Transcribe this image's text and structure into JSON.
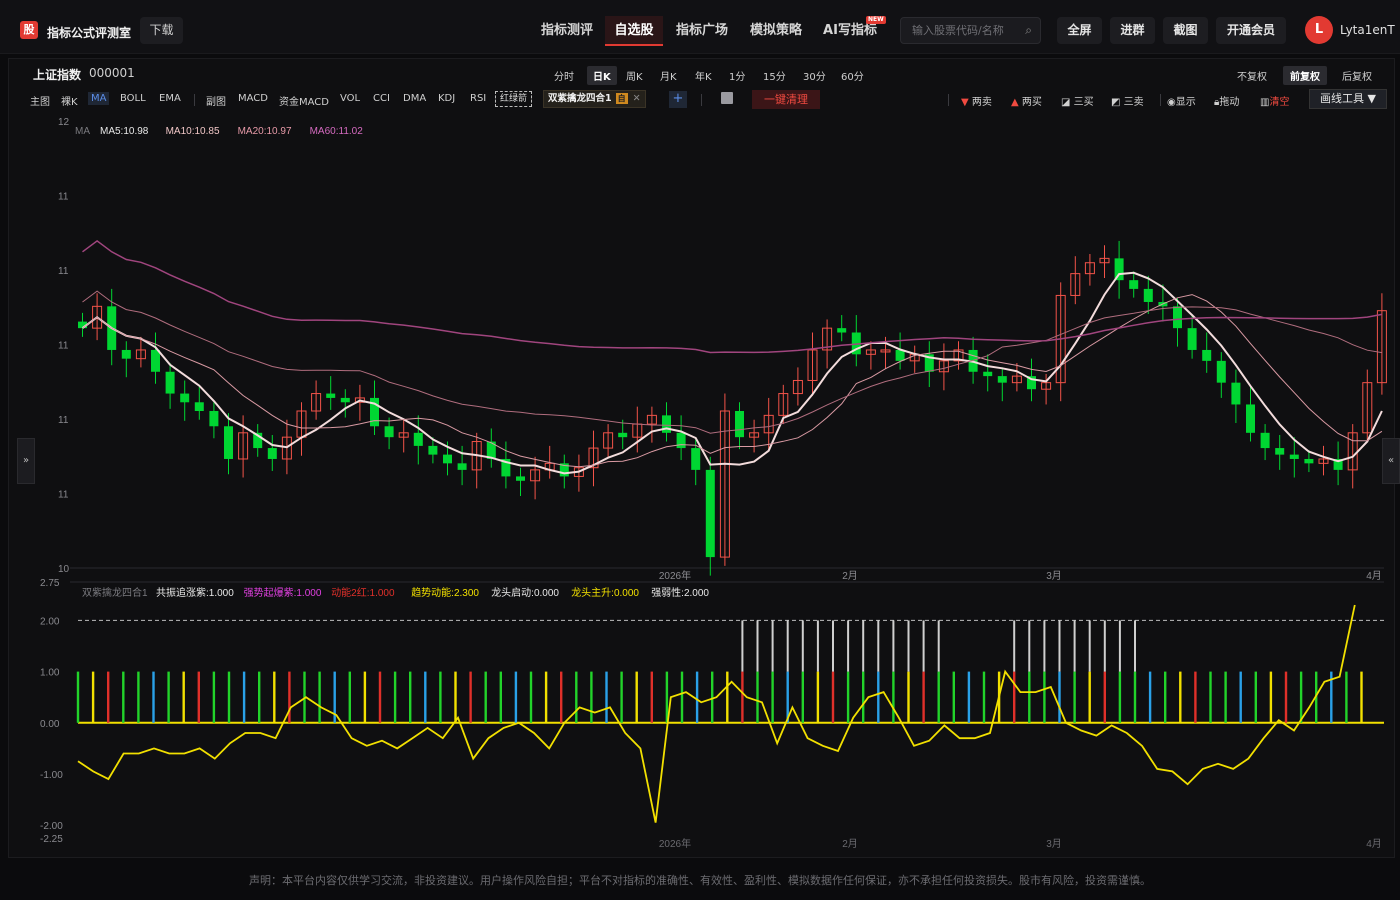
{
  "topbar": {
    "logo": "股",
    "app_name": "指标公式评测室",
    "download": "下载",
    "nav": [
      "指标测评",
      "自选股",
      "指标广场",
      "模拟策略",
      "AI写指标"
    ],
    "nav_active": 1,
    "new_badge": "NEW",
    "search_placeholder": "输入股票代码/名称",
    "buttons": [
      "全屏",
      "进群",
      "截图",
      "开通会员"
    ],
    "avatar": "L",
    "username": "Lyta1enT"
  },
  "stock": {
    "name": "上证指数",
    "code": "000001"
  },
  "periods": [
    "分时",
    "日K",
    "周K",
    "月K",
    "年K",
    "1分",
    "15分",
    "30分",
    "60分"
  ],
  "period_active": 1,
  "fuquan": [
    "不复权",
    "前复权",
    "后复权"
  ],
  "fuquan_active": 1,
  "indicators": {
    "main": [
      "主图",
      "裸K",
      "MA",
      "BOLL",
      "EMA"
    ],
    "main_active": 2,
    "sub": [
      "副图",
      "MACD",
      "资金MACD",
      "VOL",
      "CCI",
      "DMA",
      "KDJ",
      "RSI"
    ],
    "redgreen": "红绿箭",
    "combo": "双紫擒龙四合1",
    "combo_tag": "自",
    "clear": "一键清理"
  },
  "tools": [
    "两卖",
    "两买",
    "三买",
    "三卖",
    "显示",
    "拖动",
    "清空"
  ],
  "draw_tool": "画线工具 ▼",
  "side": {
    "left": "»",
    "right": "«"
  },
  "colors": {
    "up": "#f25349",
    "down": "#00d632",
    "bg": "#0f0f11"
  },
  "chart_data": [
    {
      "type": "candlestick",
      "ylim": [
        10,
        12
      ],
      "yticks": [
        "12",
        "11",
        "11",
        "11",
        "11",
        "11",
        "10"
      ],
      "xticks": [
        "2026年",
        "2月",
        "3月",
        "4月"
      ],
      "legend": [
        {
          "label": "MA",
          "value": ""
        },
        {
          "label": "MA5",
          "value": "10.98"
        },
        {
          "label": "MA10",
          "value": "10.85"
        },
        {
          "label": "MA20",
          "value": "10.97"
        },
        {
          "label": "MA60",
          "value": "11.02"
        }
      ]
    },
    {
      "type": "indicator",
      "title": "双紫擒龙四合1",
      "ylim": [
        -2.25,
        2.75
      ],
      "yticks": [
        "2.75",
        "2.00",
        "1.00",
        "0.00",
        "-1.00",
        "-2.00",
        "-2.25"
      ],
      "xticks": [
        "2026年",
        "2月",
        "3月",
        "4月"
      ],
      "legend": [
        {
          "label": "共振追涨紫",
          "value": "1.000"
        },
        {
          "label": "强势起爆紫",
          "value": "1.000"
        },
        {
          "label": "动能2红",
          "value": "1.000"
        },
        {
          "label": "趋势动能",
          "value": "2.300"
        },
        {
          "label": "龙头启动",
          "value": "0.000"
        },
        {
          "label": "龙头主升",
          "value": "0.000"
        },
        {
          "label": "强弱性",
          "value": "2.000"
        }
      ],
      "series": [
        {
          "name": "趋势动能",
          "values": [
            -0.75,
            -0.95,
            -1.1,
            -0.6,
            -0.6,
            -0.5,
            -0.6,
            -0.6,
            -0.5,
            -0.7,
            -0.4,
            -0.2,
            -0.2,
            -0.3,
            0.3,
            0.5,
            0.3,
            0.15,
            -0.3,
            -0.45,
            -0.35,
            -0.5,
            -0.3,
            -0.1,
            -0.3,
            0.1,
            -0.7,
            -0.3,
            -0.1,
            0.0,
            -0.2,
            -0.5,
            0.0,
            0.3,
            0.2,
            0.3,
            -0.2,
            -0.5,
            -1.95,
            0.5,
            0.6,
            0.4,
            0.5,
            0.8,
            0.5,
            0.4,
            -0.4,
            0.3,
            -0.3,
            -0.45,
            -0.55,
            0.1,
            0.5,
            0.6,
            0.1,
            -0.45,
            -0.35,
            -0.05,
            -0.3,
            -0.3,
            -0.2,
            1.0,
            0.6,
            0.6,
            0.7,
            0.0,
            -0.15,
            -0.25,
            -0.05,
            -0.2,
            -0.45,
            -0.9,
            -0.95,
            -1.2,
            -0.9,
            -0.8,
            -0.9,
            -0.7,
            -0.3,
            0.05,
            -0.15,
            0.3,
            0.8,
            0.9,
            2.3
          ]
        }
      ]
    }
  ],
  "disclaimer": "声明：本平台内容仅供学习交流，非投资建议。用户操作风险自担；平台不对指标的准确性、有效性、盈利性、模拟数据作任何保证，亦不承担任何投资损失。股市有风险，投资需谨慎。"
}
